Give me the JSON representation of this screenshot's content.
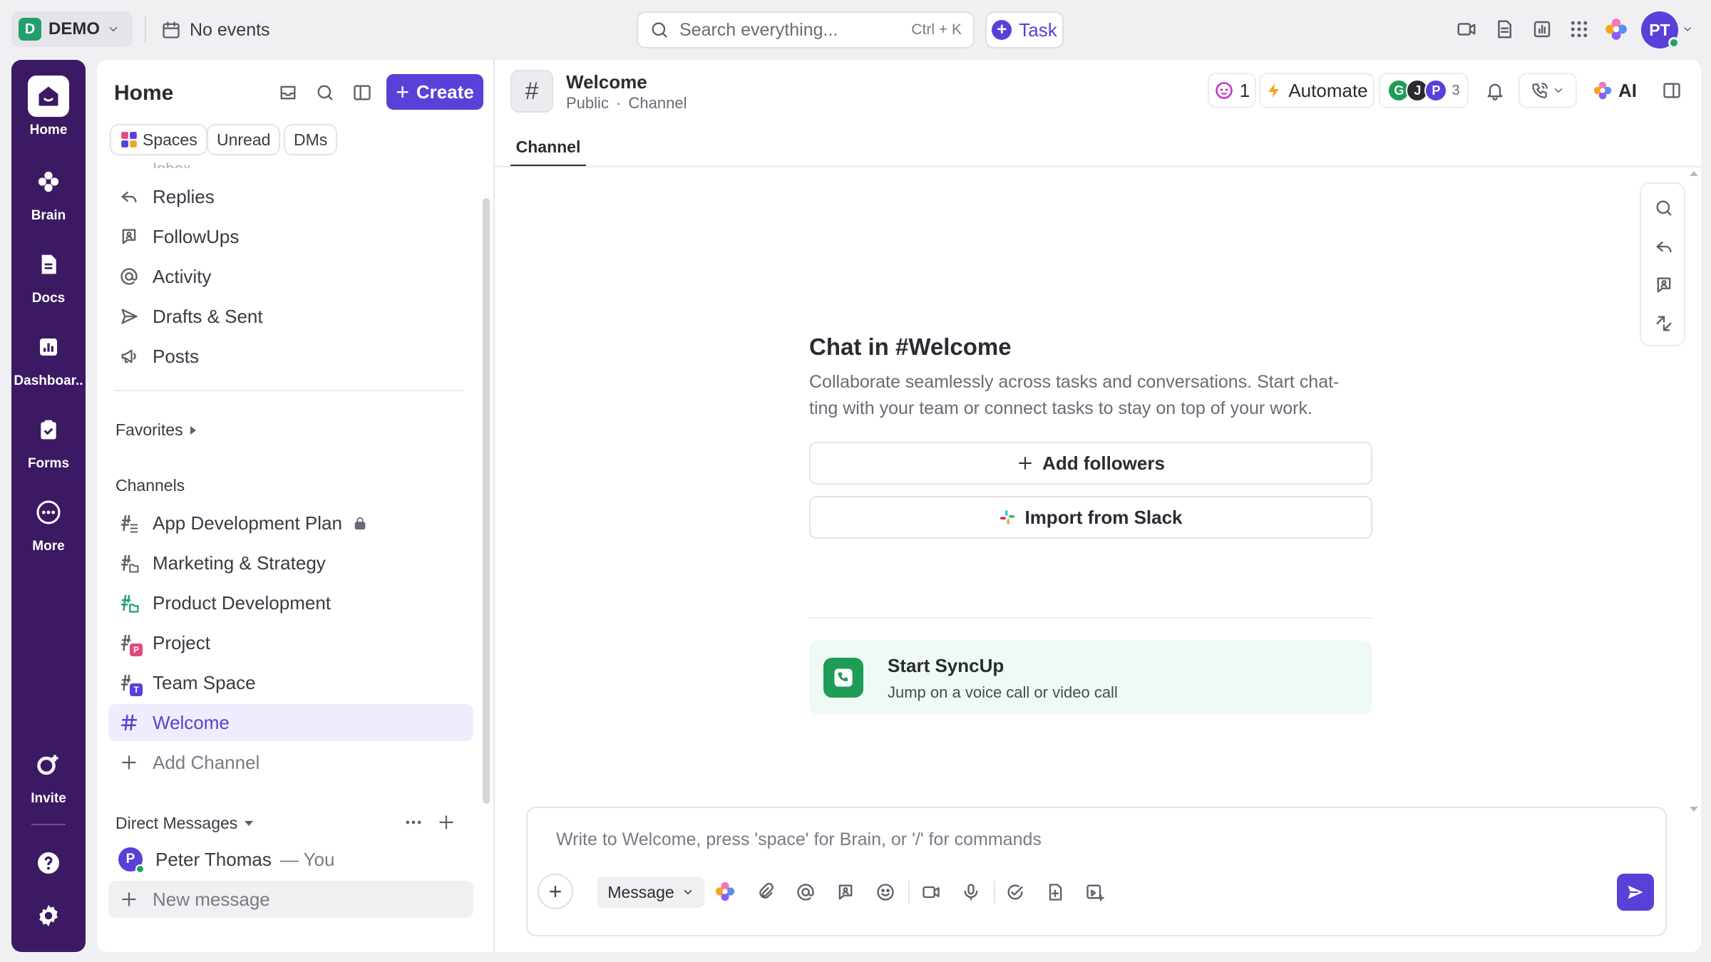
{
  "topbar": {
    "workspace_initial": "D",
    "workspace_name": "DEMO",
    "events_label": "No events",
    "search_placeholder": "Search everything...",
    "search_shortcut": "Ctrl + K",
    "task_label": "Task",
    "user_initials": "PT"
  },
  "rail": {
    "items": [
      {
        "label": "Home",
        "icon": "home-icon"
      },
      {
        "label": "Brain",
        "icon": "brain-icon"
      },
      {
        "label": "Docs",
        "icon": "docs-icon"
      },
      {
        "label": "Dashboar..",
        "icon": "dashboard-icon"
      },
      {
        "label": "Forms",
        "icon": "forms-icon"
      },
      {
        "label": "More",
        "icon": "more-icon"
      }
    ],
    "invite_label": "Invite"
  },
  "sidebar": {
    "title": "Home",
    "create_label": "Create",
    "filters": [
      "Spaces",
      "Unread",
      "DMs"
    ],
    "clipped_item": "Inbox",
    "nav": [
      {
        "label": "Replies",
        "icon": "reply-icon"
      },
      {
        "label": "FollowUps",
        "icon": "followup-icon"
      },
      {
        "label": "Activity",
        "icon": "at-icon"
      },
      {
        "label": "Drafts & Sent",
        "icon": "send-icon"
      },
      {
        "label": "Posts",
        "icon": "megaphone-icon"
      }
    ],
    "favorites_label": "Favorites",
    "channels_label": "Channels",
    "channels": [
      {
        "label": "App Development Plan",
        "badge": "",
        "locked": true
      },
      {
        "label": "Marketing & Strategy",
        "badge": "",
        "locked": false
      },
      {
        "label": "Product Development",
        "badge": "",
        "locked": false
      },
      {
        "label": "Project",
        "badge": "P",
        "locked": false
      },
      {
        "label": "Team Space",
        "badge": "T",
        "locked": false
      },
      {
        "label": "Welcome",
        "badge": "",
        "locked": false
      }
    ],
    "add_channel_label": "Add Channel",
    "dm_label": "Direct Messages",
    "dm_user_initial": "P",
    "dm_user_name": "Peter Thomas",
    "dm_you": "— You",
    "new_message_label": "New message"
  },
  "channel": {
    "icon": "#",
    "name": "Welcome",
    "visibility": "Public",
    "separator": "·",
    "type": "Channel",
    "tab": "Channel",
    "agent_count": "1",
    "automate_label": "Automate",
    "members": [
      "G",
      "J",
      "P"
    ],
    "member_count": "3",
    "ai_label": "AI"
  },
  "empty_state": {
    "title": "Chat in #Welcome",
    "description": "Collaborate seamlessly across tasks and conversations. Start chat-ting with your team or connect tasks to stay on top of your work.",
    "add_followers": "Add followers",
    "import_slack": "Import from Slack",
    "syncup_title": "Start SyncUp",
    "syncup_sub": "Jump on a voice call or video call"
  },
  "composer": {
    "placeholder": "Write to Welcome, press 'space' for Brain, or '/' for commands",
    "mode": "Message"
  },
  "colors": {
    "accent": "#5b3fd9",
    "rail": "#3b1a63",
    "workspace": "#22a06b",
    "syncup_bg": "#eefaf3"
  }
}
